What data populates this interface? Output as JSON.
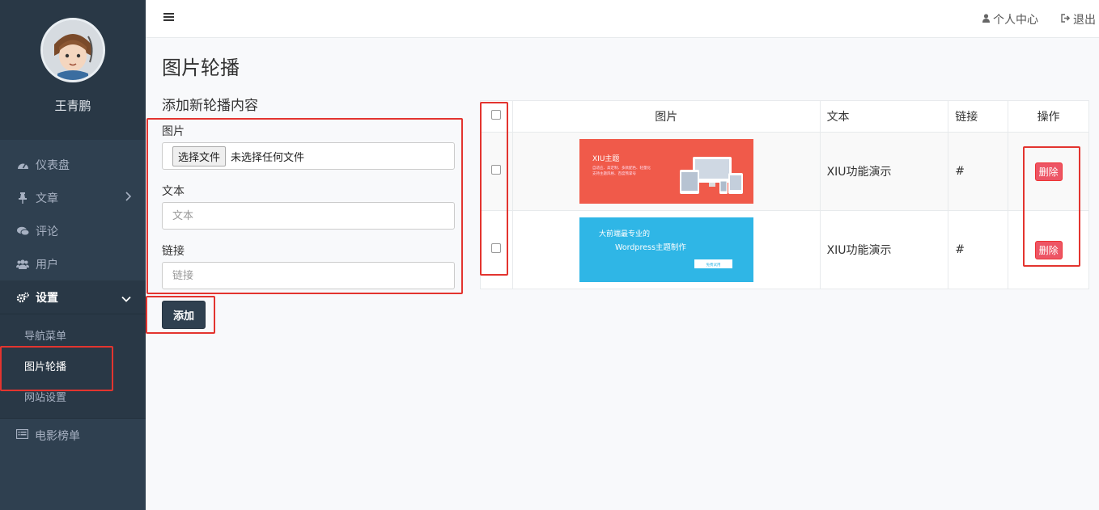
{
  "sidebar": {
    "username": "王青鹏",
    "items": [
      {
        "label": "仪表盘",
        "icon": "dashboard-icon"
      },
      {
        "label": "文章",
        "icon": "pin-icon"
      },
      {
        "label": "评论",
        "icon": "comments-icon"
      },
      {
        "label": "用户",
        "icon": "users-icon"
      },
      {
        "label": "设置",
        "icon": "cogs-icon"
      }
    ],
    "submenu": [
      "导航菜单",
      "图片轮播",
      "网站设置"
    ],
    "last_item": {
      "label": "电影榜单",
      "icon": "list-icon"
    }
  },
  "topbar": {
    "profile_label": "个人中心",
    "logout_label": "退出"
  },
  "page": {
    "title": "图片轮播"
  },
  "form": {
    "title": "添加新轮播内容",
    "image_label": "图片",
    "file_button": "选择文件",
    "file_status": "未选择任何文件",
    "text_label": "文本",
    "text_placeholder": "文本",
    "link_label": "链接",
    "link_placeholder": "链接",
    "submit_label": "添加"
  },
  "table": {
    "headers": [
      "图片",
      "文本",
      "链接",
      "操作"
    ],
    "rows": [
      {
        "banner": {
          "title": "XIU主题",
          "line1": "自适应、高定制、多款配色、轻量化",
          "line2": "支持主题风格、百度熊掌号",
          "bg": "#f05a4a"
        },
        "text": "XIU功能演示",
        "link": "#",
        "action": "删除"
      },
      {
        "banner": {
          "title": "大前端最专业的",
          "line1": "Wordpress主题制作",
          "line2": "免费试用",
          "bg": "#2fb6e6"
        },
        "text": "XIU功能演示",
        "link": "#",
        "action": "删除"
      }
    ]
  },
  "colors": {
    "sidebar": "#2f4050",
    "highlight": "#e3342f",
    "danger": "#ed5565"
  }
}
